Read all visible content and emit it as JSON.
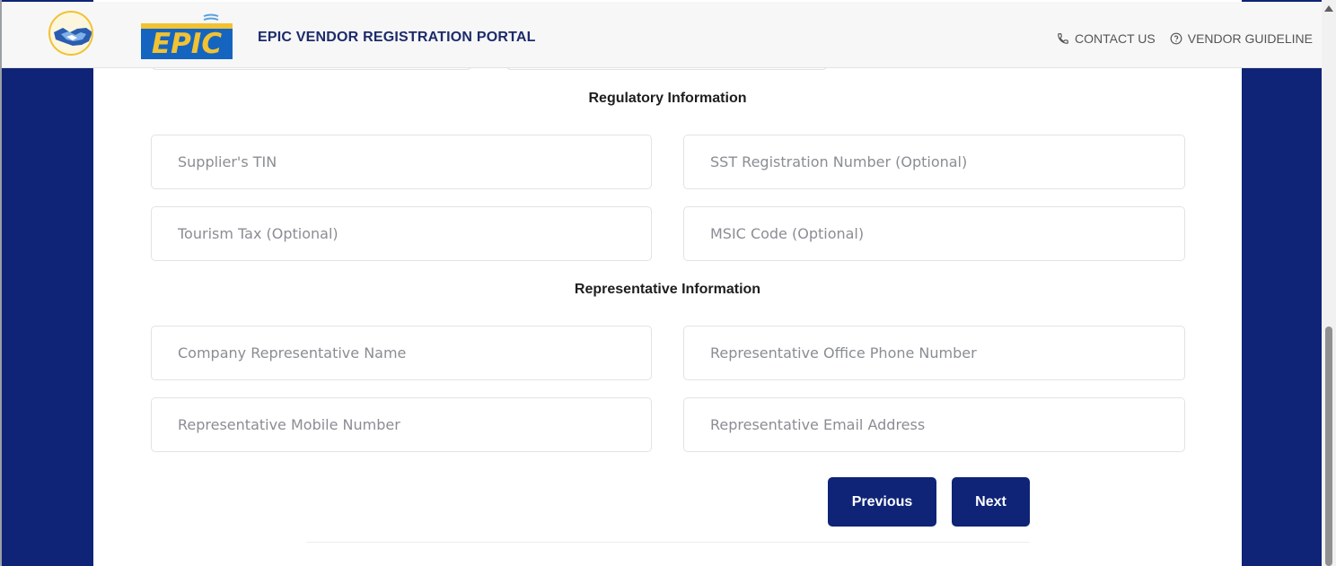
{
  "header": {
    "brand_logo_text": "EPIC",
    "title": "EPIC VENDOR REGISTRATION PORTAL",
    "links": [
      {
        "label": "CONTACT US",
        "icon": "phone-icon"
      },
      {
        "label": "VENDOR GUIDELINE",
        "icon": "help-circle-icon"
      }
    ]
  },
  "regulatory": {
    "title": "Regulatory Information",
    "fields": {
      "tin": {
        "placeholder": "Supplier's TIN",
        "value": ""
      },
      "sst": {
        "placeholder": "SST Registration Number (Optional)",
        "value": ""
      },
      "tourism": {
        "placeholder": "Tourism Tax (Optional)",
        "value": ""
      },
      "msic": {
        "placeholder": "MSIC Code (Optional)",
        "value": ""
      }
    }
  },
  "representative": {
    "title": "Representative Information",
    "fields": {
      "name": {
        "placeholder": "Company Representative Name",
        "value": ""
      },
      "office_phone": {
        "placeholder": "Representative Office Phone Number",
        "value": ""
      },
      "mobile": {
        "placeholder": "Representative Mobile Number",
        "value": ""
      },
      "email": {
        "placeholder": "Representative Email Address",
        "value": ""
      }
    }
  },
  "actions": {
    "previous_label": "Previous",
    "next_label": "Next"
  },
  "colors": {
    "brand_navy": "#0f2477",
    "logo_yellow": "#f1c232",
    "logo_blue": "#1a5fb4"
  }
}
